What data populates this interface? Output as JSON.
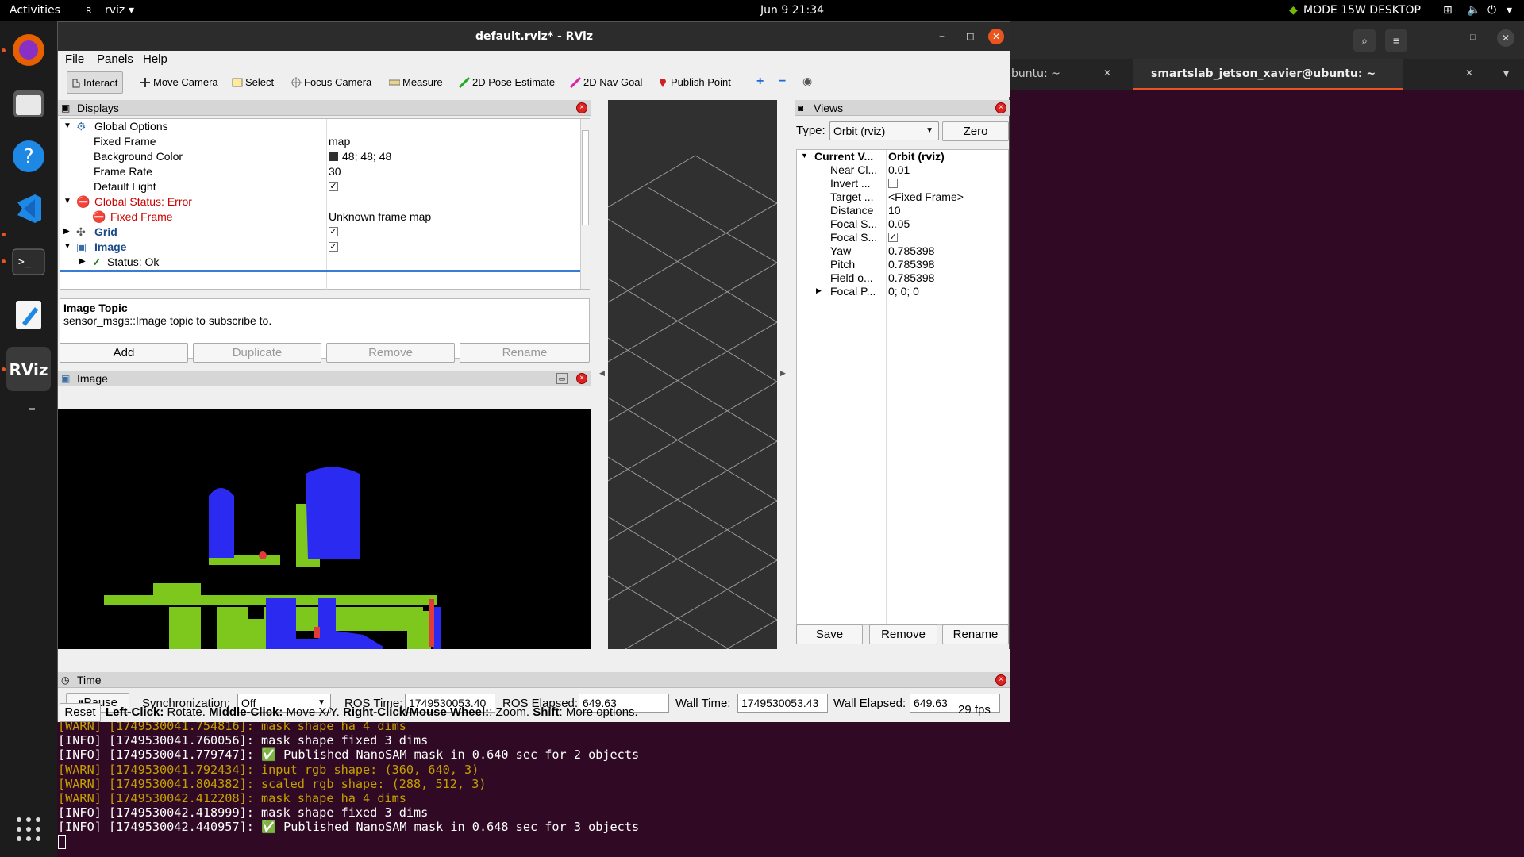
{
  "topbar": {
    "activities": "Activities",
    "app_name": "rviz",
    "clock": "Jun 9  21:34",
    "power_mode": "MODE 15W DESKTOP"
  },
  "terminal": {
    "tab_left": "buntu: ~",
    "tab_active": "smartslab_jetson_xavier@ubuntu: ~",
    "log": [
      {
        "level": "warn",
        "text": "[WARN] [1749530041.754816]: mask shape ha 4 dims"
      },
      {
        "level": "info",
        "text": "[INFO] [1749530041.760056]: mask shape fixed 3 dims"
      },
      {
        "level": "info",
        "text": "[INFO] [1749530041.779747]: ✅ Published NanoSAM mask in 0.640 sec for 2 objects"
      },
      {
        "level": "warn",
        "text": "[WARN] [1749530041.792434]: input rgb shape: (360, 640, 3)"
      },
      {
        "level": "warn",
        "text": "[WARN] [1749530041.804382]: scaled rgb shape: (288, 512, 3)"
      },
      {
        "level": "warn",
        "text": "[WARN] [1749530042.412208]: mask shape ha 4 dims"
      },
      {
        "level": "info",
        "text": "[INFO] [1749530042.418999]: mask shape fixed 3 dims"
      },
      {
        "level": "info",
        "text": "[INFO] [1749530042.440957]: ✅ Published NanoSAM mask in 0.648 sec for 3 objects"
      }
    ]
  },
  "rviz": {
    "title": "default.rviz* - RViz",
    "menu": [
      "File",
      "Panels",
      "Help"
    ],
    "tools": [
      "Interact",
      "Move Camera",
      "Select",
      "Focus Camera",
      "Measure",
      "2D Pose Estimate",
      "2D Nav Goal",
      "Publish Point"
    ],
    "displays": {
      "title": "Displays",
      "global_options": "Global Options",
      "fixed_frame_label": "Fixed Frame",
      "fixed_frame_value": "map",
      "bg_color_label": "Background Color",
      "bg_color_value": "48; 48; 48",
      "frame_rate_label": "Frame Rate",
      "frame_rate_value": "30",
      "default_light_label": "Default Light",
      "global_status": "Global Status: Error",
      "fixed_frame_err": "Fixed Frame",
      "fixed_frame_err_value": "Unknown frame map",
      "grid": "Grid",
      "image": "Image",
      "status_ok": "Status: Ok",
      "desc_title": "Image Topic",
      "desc_text": "sensor_msgs::Image topic to subscribe to.",
      "btn_add": "Add",
      "btn_duplicate": "Duplicate",
      "btn_remove": "Remove",
      "btn_rename": "Rename"
    },
    "image_panel": {
      "title": "Image"
    },
    "views": {
      "title": "Views",
      "type_label": "Type:",
      "type_value": "Orbit (rviz)",
      "zero": "Zero",
      "header_name": "Current V...",
      "header_value": "Orbit (rviz)",
      "props": [
        {
          "name": "Near Cl...",
          "value": "0.01"
        },
        {
          "name": "Invert ...",
          "value": ""
        },
        {
          "name": "Target ...",
          "value": "<Fixed Frame>"
        },
        {
          "name": "Distance",
          "value": "10"
        },
        {
          "name": "Focal S...",
          "value": "0.05"
        },
        {
          "name": "Focal S...",
          "value": ""
        },
        {
          "name": "Yaw",
          "value": "0.785398"
        },
        {
          "name": "Pitch",
          "value": "0.785398"
        },
        {
          "name": "Field o...",
          "value": "0.785398"
        },
        {
          "name": "Focal P...",
          "value": "0; 0; 0"
        }
      ],
      "btn_save": "Save",
      "btn_remove": "Remove",
      "btn_rename": "Rename"
    },
    "time": {
      "title": "Time",
      "pause": "Pause",
      "sync_label": "Synchronization:",
      "sync_value": "Off",
      "ros_time_label": "ROS Time:",
      "ros_time": "1749530053.40",
      "ros_elapsed_label": "ROS Elapsed:",
      "ros_elapsed": "649.63",
      "wall_time_label": "Wall Time:",
      "wall_time": "1749530053.43",
      "wall_elapsed_label": "Wall Elapsed:",
      "wall_elapsed": "649.63"
    },
    "status": {
      "reset": "Reset",
      "left_click": "Left-Click:",
      "left_click_txt": " Rotate. ",
      "middle_click": "Middle-Click:",
      "middle_click_txt": " Move X/Y. ",
      "right_click": "Right-Click/Mouse Wheel:",
      "right_click_txt": ": Zoom. ",
      "shift": "Shift",
      "shift_txt": ": More options.",
      "fps": "29 fps"
    }
  }
}
